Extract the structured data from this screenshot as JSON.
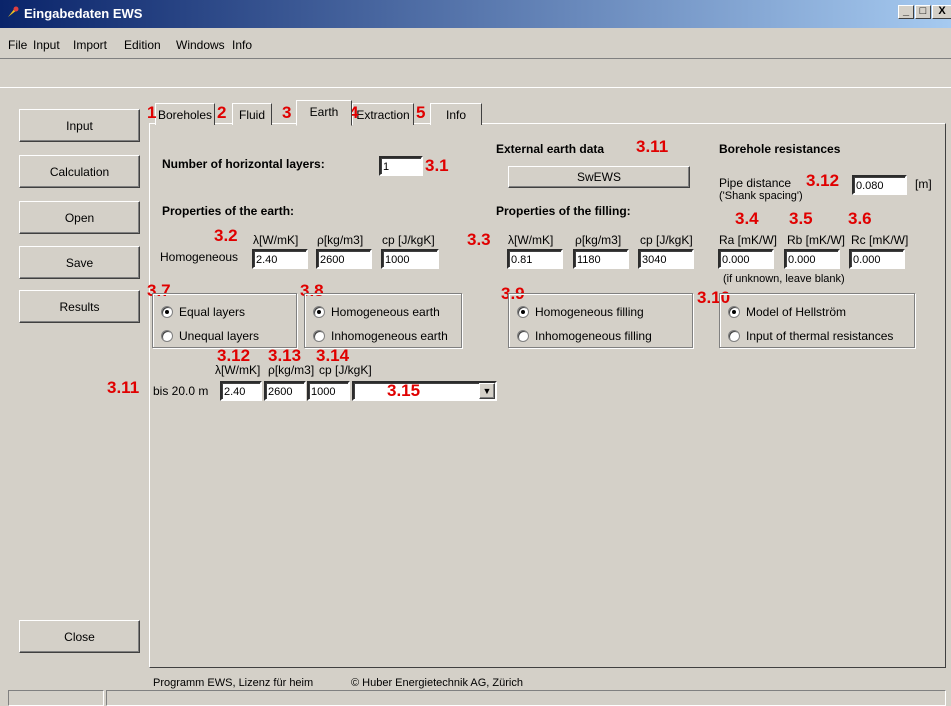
{
  "window": {
    "title": "Eingabedaten EWS",
    "min_glyph": "_",
    "max_glyph": "□",
    "close_glyph": "X"
  },
  "menu": [
    "File",
    "Input",
    "Import",
    "Edition",
    "Windows",
    "Info"
  ],
  "sidebar": {
    "input": "Input",
    "calculation": "Calculation",
    "open": "Open",
    "save": "Save",
    "results": "Results",
    "close": "Close"
  },
  "tabs": [
    {
      "num": "1",
      "label": "Boreholes"
    },
    {
      "num": "2",
      "label": "Fluid"
    },
    {
      "num": "3",
      "label": "Earth"
    },
    {
      "num": "4",
      "label": "Extraction"
    },
    {
      "num": "5",
      "label": "Info"
    }
  ],
  "earth": {
    "layers_label": "Number of horizontal layers:",
    "layers_value": "1",
    "props_title": "Properties of the earth:",
    "lambda_label": "λ[W/mK]",
    "rho_label": "ρ[kg/m3]",
    "cp_label": "cp [J/kgK]",
    "homogeneous": "Homogeneous",
    "lambda": "2.40",
    "rho": "2600",
    "cp": "1000"
  },
  "external": {
    "title": "External earth data",
    "button": "SwEWS"
  },
  "filling": {
    "title": "Properties of the filling:",
    "lambda_label": "λ[W/mK]",
    "rho_label": "ρ[kg/m3]",
    "cp_label": "cp [J/kgK]",
    "lambda": "0.81",
    "rho": "1180",
    "cp": "3040"
  },
  "resistances": {
    "title": "Borehole resistances",
    "pipe_label": "Pipe distance",
    "pipe_sub": "('Shank spacing')",
    "pipe_value": "0.080",
    "pipe_unit": "[m]",
    "ra_label": "Ra [mK/W]",
    "rb_label": "Rb [mK/W]",
    "rc_label": "Rc [mK/W]",
    "ra": "0.000",
    "rb": "0.000",
    "rc": "0.000",
    "hint": "(if unknown, leave blank)"
  },
  "radios": {
    "equal": "Equal layers",
    "unequal": "Unequal layers",
    "homog_earth": "Homogeneous earth",
    "inhomog_earth": "Inhomogeneous earth",
    "homog_fill": "Homogeneous filling",
    "inhomog_fill": "Inhomogeneous filling",
    "hellstrom": "Model of Hellström",
    "thermal": "Input of thermal resistances"
  },
  "layer": {
    "lambda_label": "λ[W/mK]",
    "rho_label": "ρ[kg/m3]",
    "cp_label": "cp [J/kgK]",
    "depth": "bis 20.0 m",
    "lambda": "2.40",
    "rho": "2600",
    "cp": "1000",
    "dropdown_arrow": "▼"
  },
  "footer": {
    "program": "Programm EWS, Lizenz für heim",
    "copyright": "© Huber Energietechnik AG, Zürich"
  },
  "annotations": {
    "a3_1": "3.1",
    "a3_2": "3.2",
    "a3_3": "3.3",
    "a3_4": "3.4",
    "a3_5": "3.5",
    "a3_6": "3.6",
    "a3_7": "3.7",
    "a3_8": "3.8",
    "a3_9": "3.9",
    "a3_10": "3.10",
    "a3_11a": "3.11",
    "a3_11b": "3.11",
    "a3_12a": "3.12",
    "a3_12b": "3.12",
    "a3_13": "3.13",
    "a3_14": "3.14",
    "a3_15": "3.15"
  }
}
